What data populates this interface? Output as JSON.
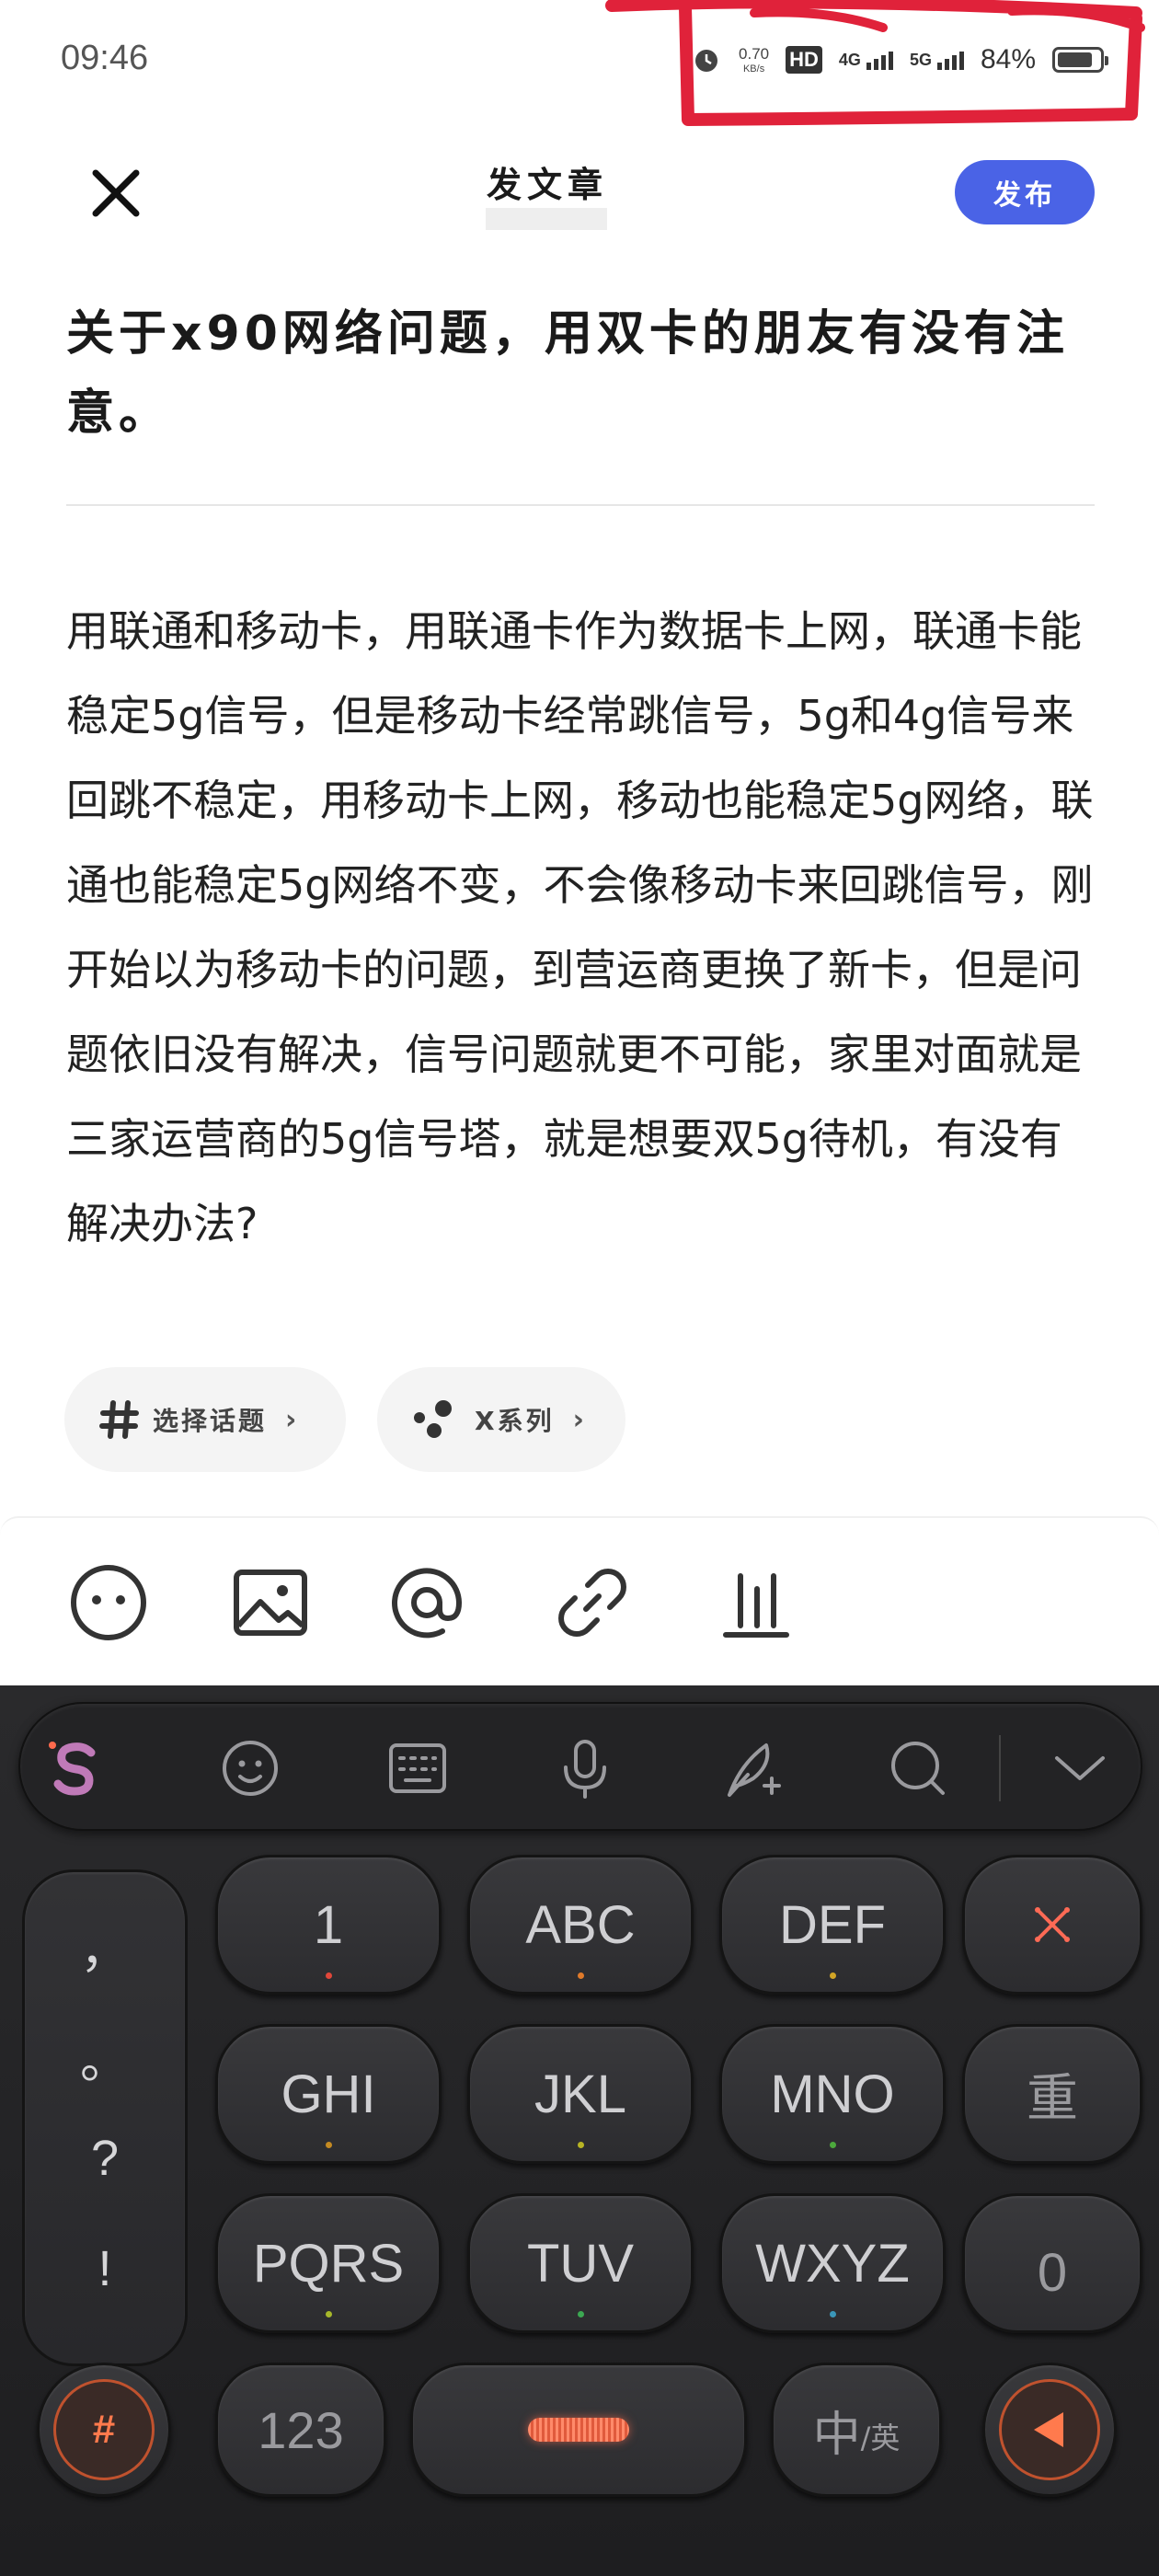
{
  "status_bar": {
    "time": "09:46",
    "net_speed": "0.70",
    "net_speed_unit": "KB/s",
    "hd_label": "HD",
    "network_1": "4G",
    "network_2": "5G",
    "battery_percent": "84%",
    "battery_level": 0.84
  },
  "header": {
    "title": "发文章",
    "publish_label": "发布"
  },
  "article": {
    "title": "关于x90网络问题，用双卡的朋友有没有注意。",
    "body": "用联通和移动卡，用联通卡作为数据卡上网，联通卡能稳定5g信号，但是移动卡经常跳信号，5g和4g信号来回跳不稳定，用移动卡上网，移动也能稳定5g网络，联通也能稳定5g网络不变，不会像移动卡来回跳信号，刚开始以为移动卡的问题，到营运商更换了新卡，但是问题依旧没有解决，信号问题就更不可能，家里对面就是三家运营商的5g信号塔，就是想要双5g待机，有没有解决办法?"
  },
  "chips": {
    "topic_label": "选择话题",
    "series_label": "X系列"
  },
  "toolbar": {
    "icons": [
      "emoji-icon",
      "image-icon",
      "mention-icon",
      "link-icon",
      "poll-icon"
    ]
  },
  "keyboard": {
    "top_icons": [
      "sogou-logo-icon",
      "emoji-icon",
      "keyboard-icon",
      "microphone-icon",
      "handwriting-icon",
      "search-icon",
      "collapse-chevron-icon"
    ],
    "punctuation": [
      "，",
      "。",
      "?",
      "!"
    ],
    "keys": {
      "k1": "1",
      "k2": "ABC",
      "k3": "DEF",
      "k4": "GHI",
      "k5": "JKL",
      "k6": "MNO",
      "k7": "PQRS",
      "k8": "TUV",
      "k9": "WXYZ",
      "reenter": "重",
      "zero": "0",
      "symbol": "#",
      "num": "123",
      "lang_main": "中",
      "lang_sub": "/英"
    },
    "accent_color": "#ff6a4d"
  }
}
